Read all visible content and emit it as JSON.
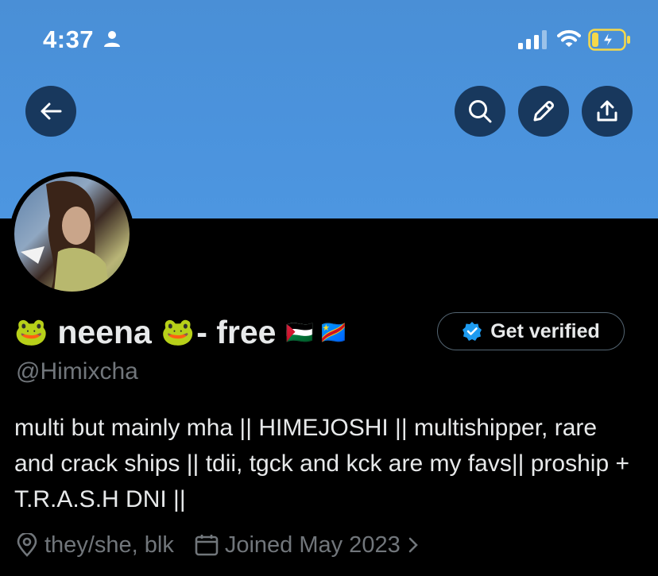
{
  "status_bar": {
    "time": "4:37",
    "icons": [
      "person-icon",
      "signal-icon",
      "wifi-icon",
      "battery-charging-icon"
    ]
  },
  "header": {
    "buttons": [
      "back-icon",
      "search-icon",
      "edit-icon",
      "share-icon"
    ],
    "banner_color": "#4b93dd"
  },
  "profile": {
    "display_name_prefix": "🐸",
    "display_name": "neena",
    "display_name_suffix_emoji": "🐸",
    "display_name_tail": "- free",
    "flags": [
      "🇵🇸",
      "🇨🇩"
    ],
    "handle": "@Himixcha",
    "verify_label": "Get verified",
    "bio": "multi but mainly mha || HIMEJOSHI || multishipper, rare and crack ships || tdii, tgck and kck are my favs|| proship + T.R.A.S.H DNI ||",
    "location": "they/she, blk",
    "joined": "Joined May 2023"
  },
  "colors": {
    "background": "#000000",
    "text": "#e7e9ea",
    "muted": "#71767b",
    "verified_blue": "#1d9bf0"
  }
}
